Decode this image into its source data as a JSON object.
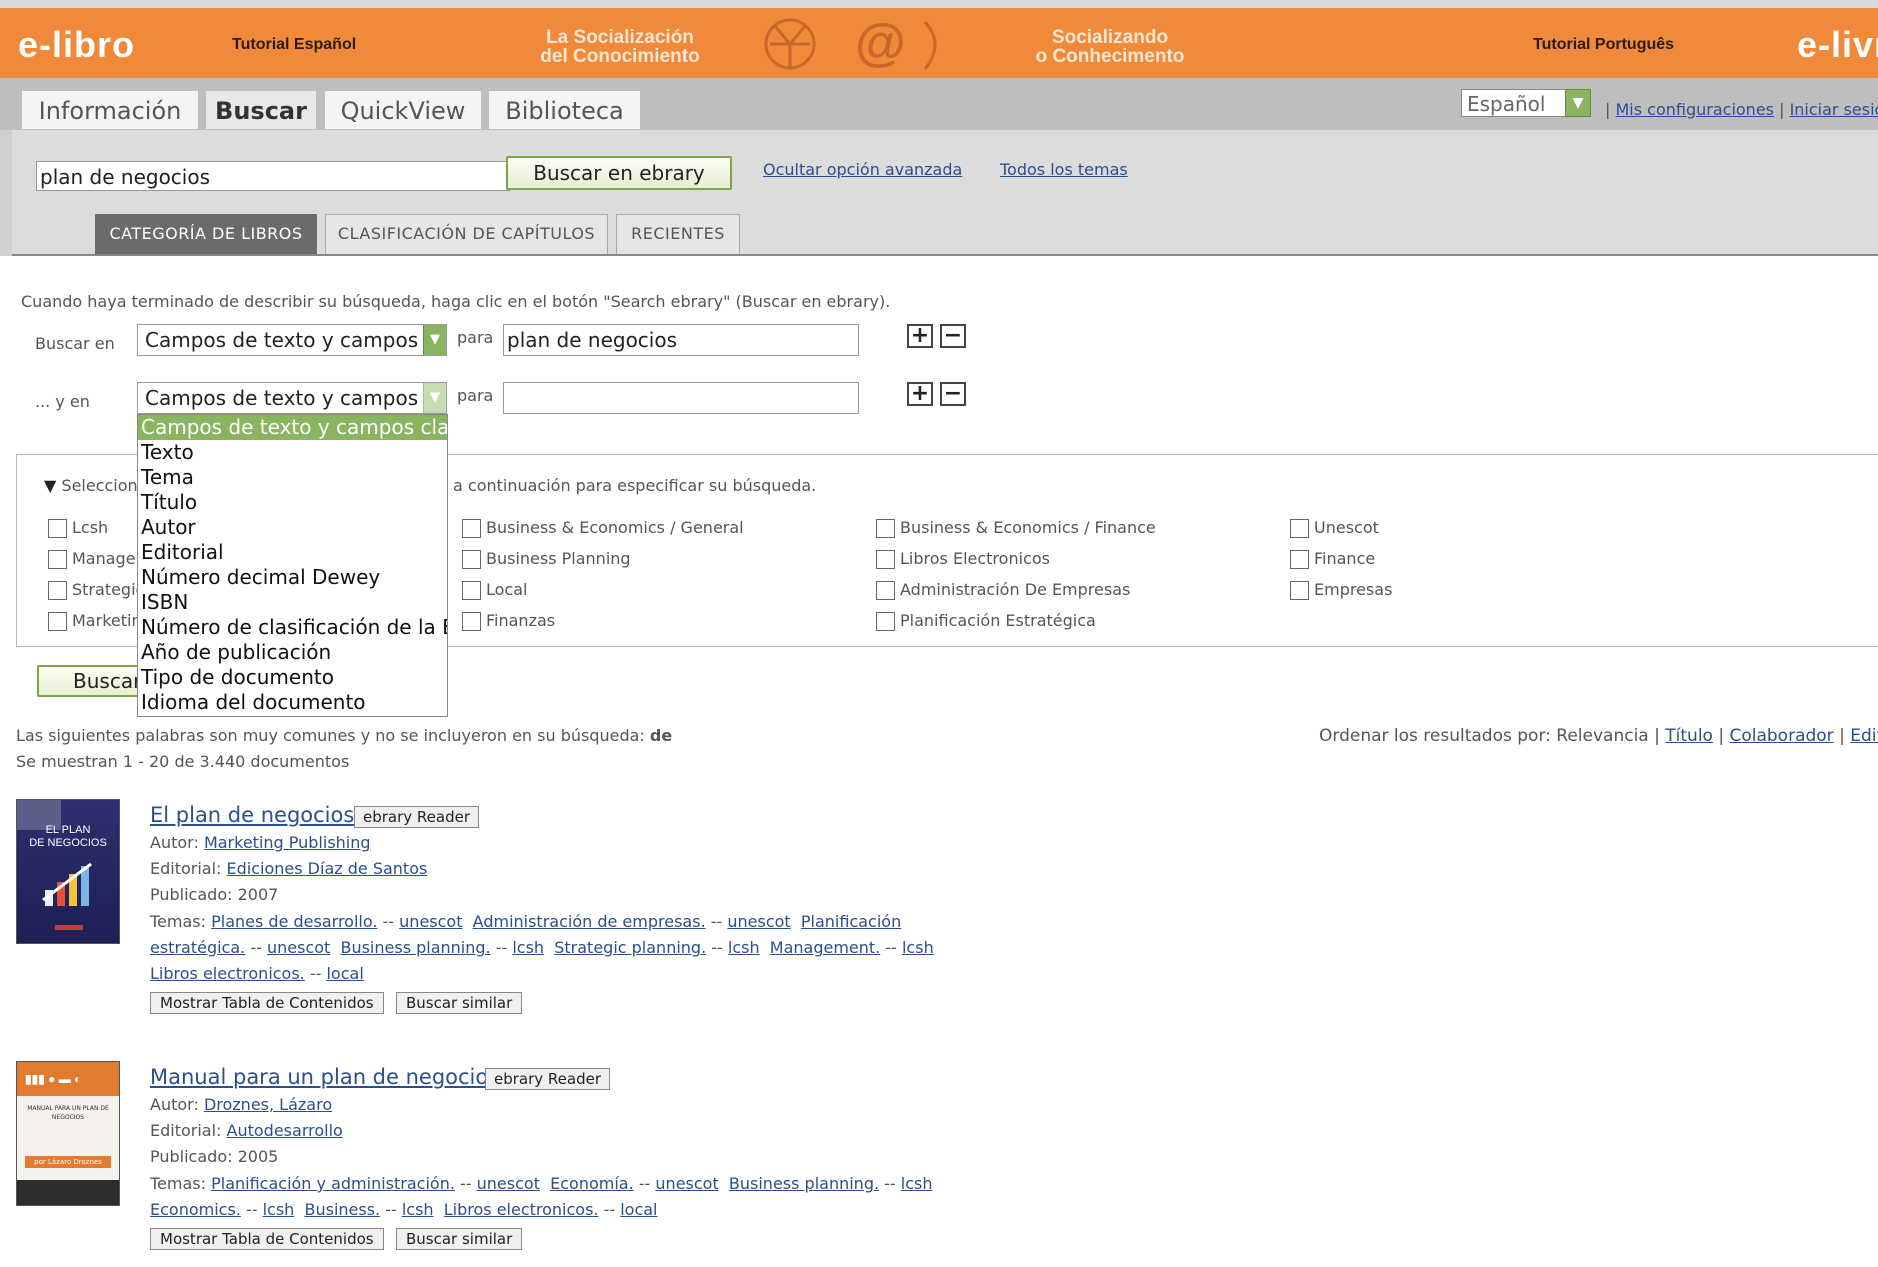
{
  "header": {
    "logo_left": "e-libro",
    "tutorial_es": "Tutorial Español",
    "slogan_es_1": "La Socialización",
    "slogan_es_2": "del Conocimiento",
    "slogan_pt_1": "Socializando",
    "slogan_pt_2": "o Conhecimento",
    "tutorial_pt": "Tutorial Português",
    "logo_right": "e-livro",
    "accent": "#f08a3a"
  },
  "tabs": {
    "informacion": "Información",
    "buscar": "Buscar",
    "quickview": "QuickView",
    "biblioteca": "Biblioteca"
  },
  "language": {
    "selected": "Español"
  },
  "top_links": {
    "config": "Mis configuraciones",
    "login": "Iniciar sesión"
  },
  "search": {
    "query": "plan de negocios",
    "button": "Buscar en ebrary",
    "hide_advanced": "Ocultar opción avanzada",
    "all_topics": "Todos los temas"
  },
  "subtabs": {
    "categoria": "CATEGORÍA DE LIBROS",
    "clasificacion": "CLASIFICACIÓN DE CAPÍTULOS",
    "recientes": "RECIENTES"
  },
  "advanced": {
    "instruction": "Cuando haya terminado de describir su búsqueda, haga clic en el botón \"Search ebrary\" (Buscar en ebrary).",
    "row1_label": "Buscar en",
    "row1_field": "Campos de texto y campos clave",
    "for_label": "para",
    "row1_value": "plan de negocios",
    "row2_label": "... y en",
    "row2_field": "Campos de texto y campos clave",
    "row2_value": "",
    "plus": "+",
    "minus": "−"
  },
  "dropdown_options": [
    "Campos de texto y campos clave",
    "Texto",
    "Tema",
    "Título",
    "Autor",
    "Editorial",
    "Número decimal Dewey",
    "ISBN",
    "Número de clasificación de la Biblioteca del Congreso",
    "Año de publicación",
    "Tipo de documento",
    "Idioma del documento"
  ],
  "subjects": {
    "heading_start": "Seleccione",
    "heading_end": "a continuación para especificar su búsqueda.",
    "col1": [
      "Lcsh",
      "Management",
      "Strategic planning",
      "Marketing"
    ],
    "col2": [
      "Business & Economics / General",
      "Business Planning",
      "Local",
      "Finanzas"
    ],
    "col3": [
      "Business & Economics / Finance",
      "Libros Electronicos",
      "Administración De Empresas",
      "Planificación Estratégica"
    ],
    "col4": [
      "Unescot",
      "Finance",
      "Empresas"
    ],
    "search_button": "Buscar"
  },
  "results_meta": {
    "stopwords_text": "Las siguientes palabras son muy comunes y no se incluyeron en su búsqueda:",
    "stopwords_word": "de",
    "count": "Se muestran 1 - 20 de 3.440 documentos",
    "sort_label": "Ordenar los resultados por:",
    "sort_current": "Relevancia",
    "sort_titulo": "Título",
    "sort_colaborador": "Colaborador",
    "sort_editorial": "Editorial"
  },
  "labels": {
    "autor": "Autor:",
    "editorial": "Editorial:",
    "publicado": "Publicado:",
    "temas": "Temas:",
    "reader": "ebrary Reader",
    "show_toc": "Mostrar Tabla de Contenidos",
    "similar": "Buscar similar"
  },
  "results": [
    {
      "title": "El plan de negocios",
      "author": "Marketing Publishing",
      "publisher": "Ediciones Díaz de Santos",
      "year": "2007",
      "cover_text_1": "EL PLAN",
      "cover_text_2": "DE NEGOCIOS",
      "temas_line1": [
        {
          "t": "Planes de desarrollo.",
          "s": "unescot"
        },
        {
          "t": "Administración de empresas.",
          "s": "unescot"
        },
        {
          "t": "Planificación",
          "s": ""
        }
      ],
      "temas_line2": [
        {
          "t": "estratégica.",
          "s": "unescot"
        },
        {
          "t": "Business planning.",
          "s": "lcsh"
        },
        {
          "t": "Strategic planning.",
          "s": "lcsh"
        },
        {
          "t": "Management.",
          "s": "lcsh"
        }
      ],
      "temas_line3": [
        {
          "t": "Libros electronicos.",
          "s": "local"
        }
      ]
    },
    {
      "title": "Manual para un plan de negocios",
      "author": "Droznes, Lázaro",
      "publisher": "Autodesarrollo",
      "year": "2005",
      "cover_text_1": "MANUAL PARA UN PLAN DE NEGOCIOS",
      "cover_text_2": "por Lázaro Droznes",
      "temas_line1": [
        {
          "t": "Planificación y administración.",
          "s": "unescot"
        },
        {
          "t": "Economía.",
          "s": "unescot"
        },
        {
          "t": "Business planning.",
          "s": "lcsh"
        }
      ],
      "temas_line2": [
        {
          "t": "Economics.",
          "s": "lcsh"
        },
        {
          "t": "Business.",
          "s": "lcsh"
        },
        {
          "t": "Libros electronicos.",
          "s": "local"
        }
      ]
    }
  ]
}
